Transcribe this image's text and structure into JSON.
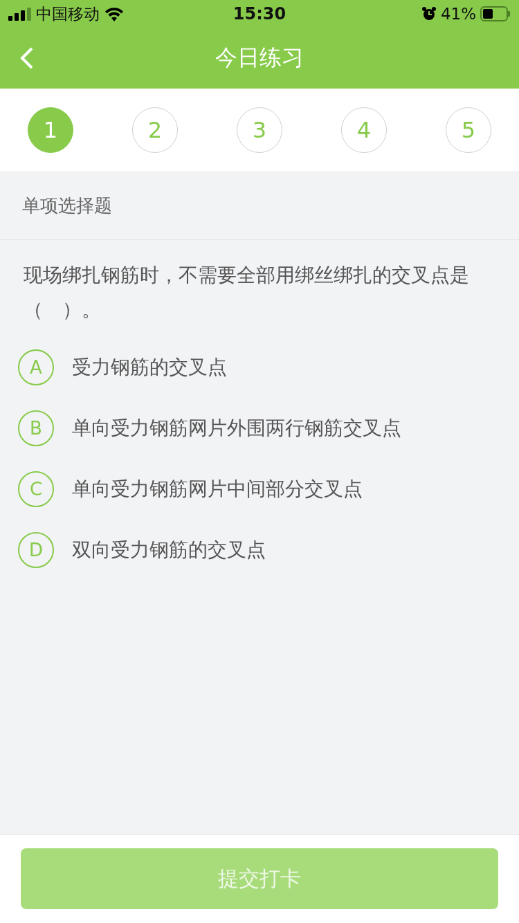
{
  "status_bar": {
    "carrier": "中国移动",
    "time": "15:30",
    "battery": "41%"
  },
  "nav": {
    "title": "今日练习"
  },
  "steps": [
    {
      "label": "1",
      "selected": true
    },
    {
      "label": "2",
      "selected": false
    },
    {
      "label": "3",
      "selected": false
    },
    {
      "label": "4",
      "selected": false
    },
    {
      "label": "5",
      "selected": false
    }
  ],
  "section": {
    "title": "单项选择题"
  },
  "question": {
    "text": "现场绑扎钢筋时，不需要全部用绑丝绑扎的交叉点是（　）。",
    "options": [
      {
        "letter": "A",
        "text": "受力钢筋的交叉点",
        "selected": false
      },
      {
        "letter": "B",
        "text": "单向受力钢筋网片外围两行钢筋交叉点",
        "selected": false
      },
      {
        "letter": "C",
        "text": "单向受力钢筋网片中间部分交叉点",
        "selected": false
      },
      {
        "letter": "D",
        "text": "双向受力钢筋的交叉点",
        "selected": false
      }
    ]
  },
  "submit": {
    "label": "提交打卡",
    "disabled": true
  }
}
